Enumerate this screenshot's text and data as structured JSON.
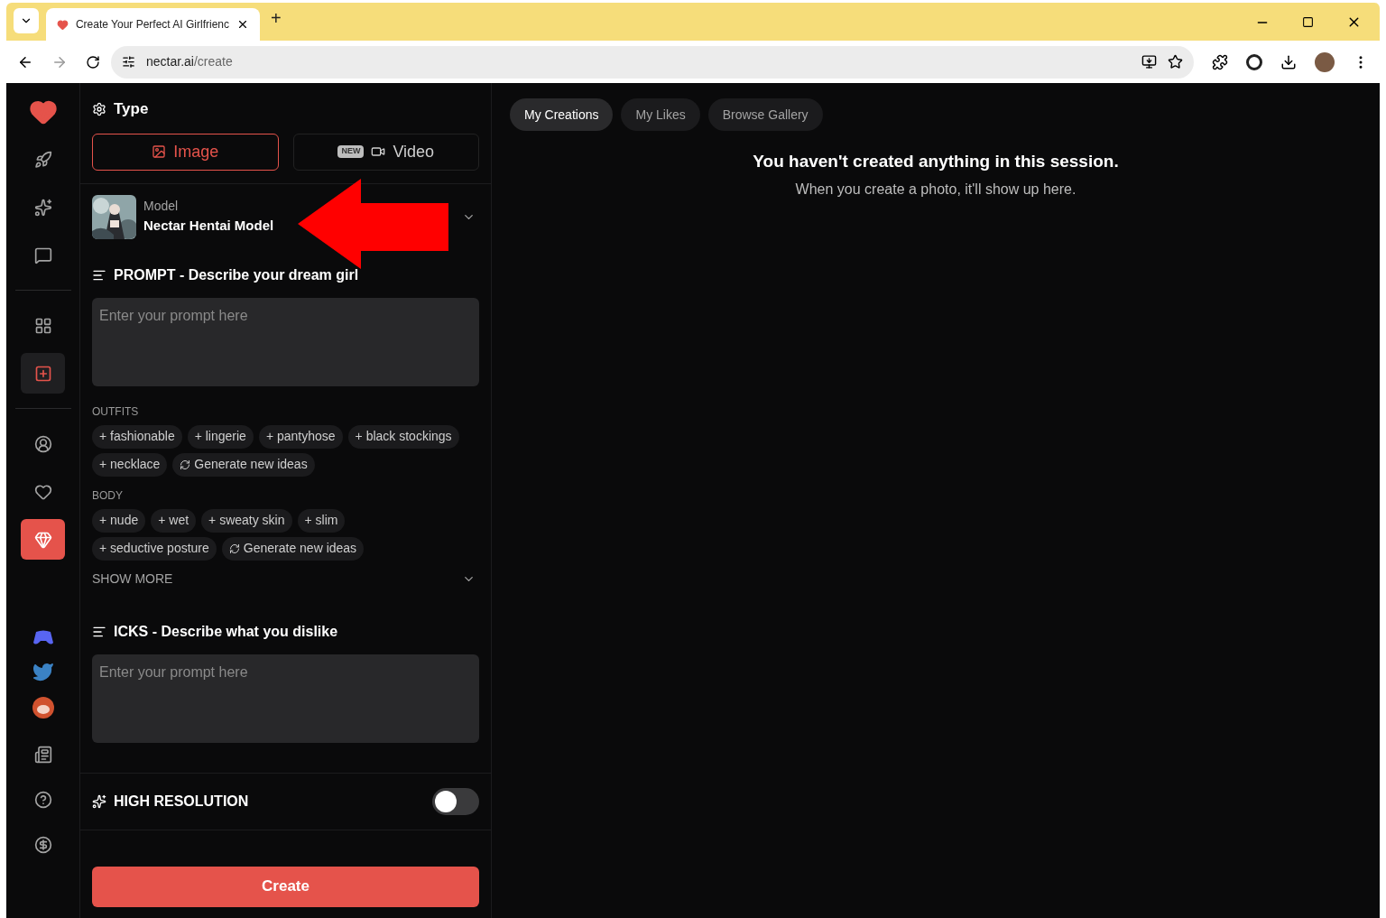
{
  "browser": {
    "tab_title": "Create Your Perfect AI Girlfrienc",
    "url_host": "nectar.ai",
    "url_path": "/create",
    "new_tab": "+"
  },
  "sidebar": {
    "items": [
      {
        "selected": false
      },
      {
        "selected": false
      },
      {
        "selected": false
      },
      {
        "selected": false
      },
      {
        "selected": true
      },
      {
        "selected": false
      },
      {
        "selected": false
      },
      {
        "selected": false
      }
    ]
  },
  "type": {
    "title": "Type",
    "options": [
      {
        "label": "Image",
        "selected": true
      },
      {
        "label": "Video",
        "selected": false,
        "badge": "NEW"
      }
    ]
  },
  "model": {
    "label": "Model",
    "name": "Nectar Hentai Model"
  },
  "prompt": {
    "title": "PROMPT - Describe your dream girl",
    "placeholder": "Enter your prompt here"
  },
  "tag_groups": [
    {
      "title": "OUTFITS",
      "tags": [
        {
          "label": "+ fashionable",
          "kind": "tag"
        },
        {
          "label": "+ lingerie",
          "kind": "tag"
        },
        {
          "label": "+ pantyhose",
          "kind": "tag"
        },
        {
          "label": "+ black stockings",
          "kind": "tag"
        },
        {
          "label": "+ necklace",
          "kind": "tag"
        },
        {
          "label": "Generate new ideas",
          "kind": "generate"
        }
      ]
    },
    {
      "title": "BODY",
      "tags": [
        {
          "label": "+ nude",
          "kind": "tag"
        },
        {
          "label": "+ wet",
          "kind": "tag"
        },
        {
          "label": "+ sweaty skin",
          "kind": "tag"
        },
        {
          "label": "+ slim",
          "kind": "tag"
        },
        {
          "label": "+ seductive posture",
          "kind": "tag"
        },
        {
          "label": "Generate new ideas",
          "kind": "generate"
        }
      ]
    }
  ],
  "show_more": "SHOW MORE",
  "icks": {
    "title": "ICKS - Describe what you dislike",
    "placeholder": "Enter your prompt here"
  },
  "high_resolution": {
    "label": "HIGH RESOLUTION",
    "on": false
  },
  "create_button": "Create",
  "gallery_tabs": [
    {
      "label": "My Creations",
      "selected": true
    },
    {
      "label": "My Likes",
      "selected": false
    },
    {
      "label": "Browse Gallery",
      "selected": false
    }
  ],
  "empty_state": {
    "title": "You haven't created anything in this session.",
    "subtitle": "When you create a photo, it'll show up here."
  }
}
